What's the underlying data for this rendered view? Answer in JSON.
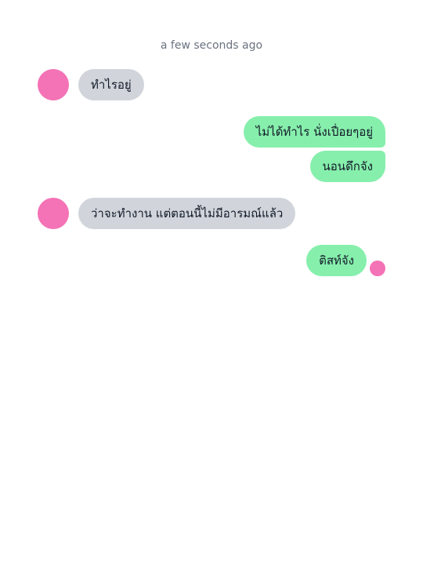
{
  "colors": {
    "avatar": "#f472b6",
    "incoming_bubble": "#d1d5db",
    "outgoing_bubble": "#86efac",
    "timestamp_text": "#6b7280"
  },
  "chat": {
    "timestamp": "a few seconds ago",
    "messages": [
      {
        "direction": "incoming",
        "text": "ทำไรอยู่"
      },
      {
        "direction": "outgoing",
        "text": "ไม่ได้ทำไร นั่งเปื่อยๆอยู่"
      },
      {
        "direction": "outgoing",
        "text": "นอนดึกจัง"
      },
      {
        "direction": "incoming",
        "text": "ว่าจะทำงาน แต่ตอนนี้ไม่มีอารมณ์แล้ว"
      },
      {
        "direction": "outgoing",
        "text": "ติสท์จัง"
      }
    ]
  }
}
